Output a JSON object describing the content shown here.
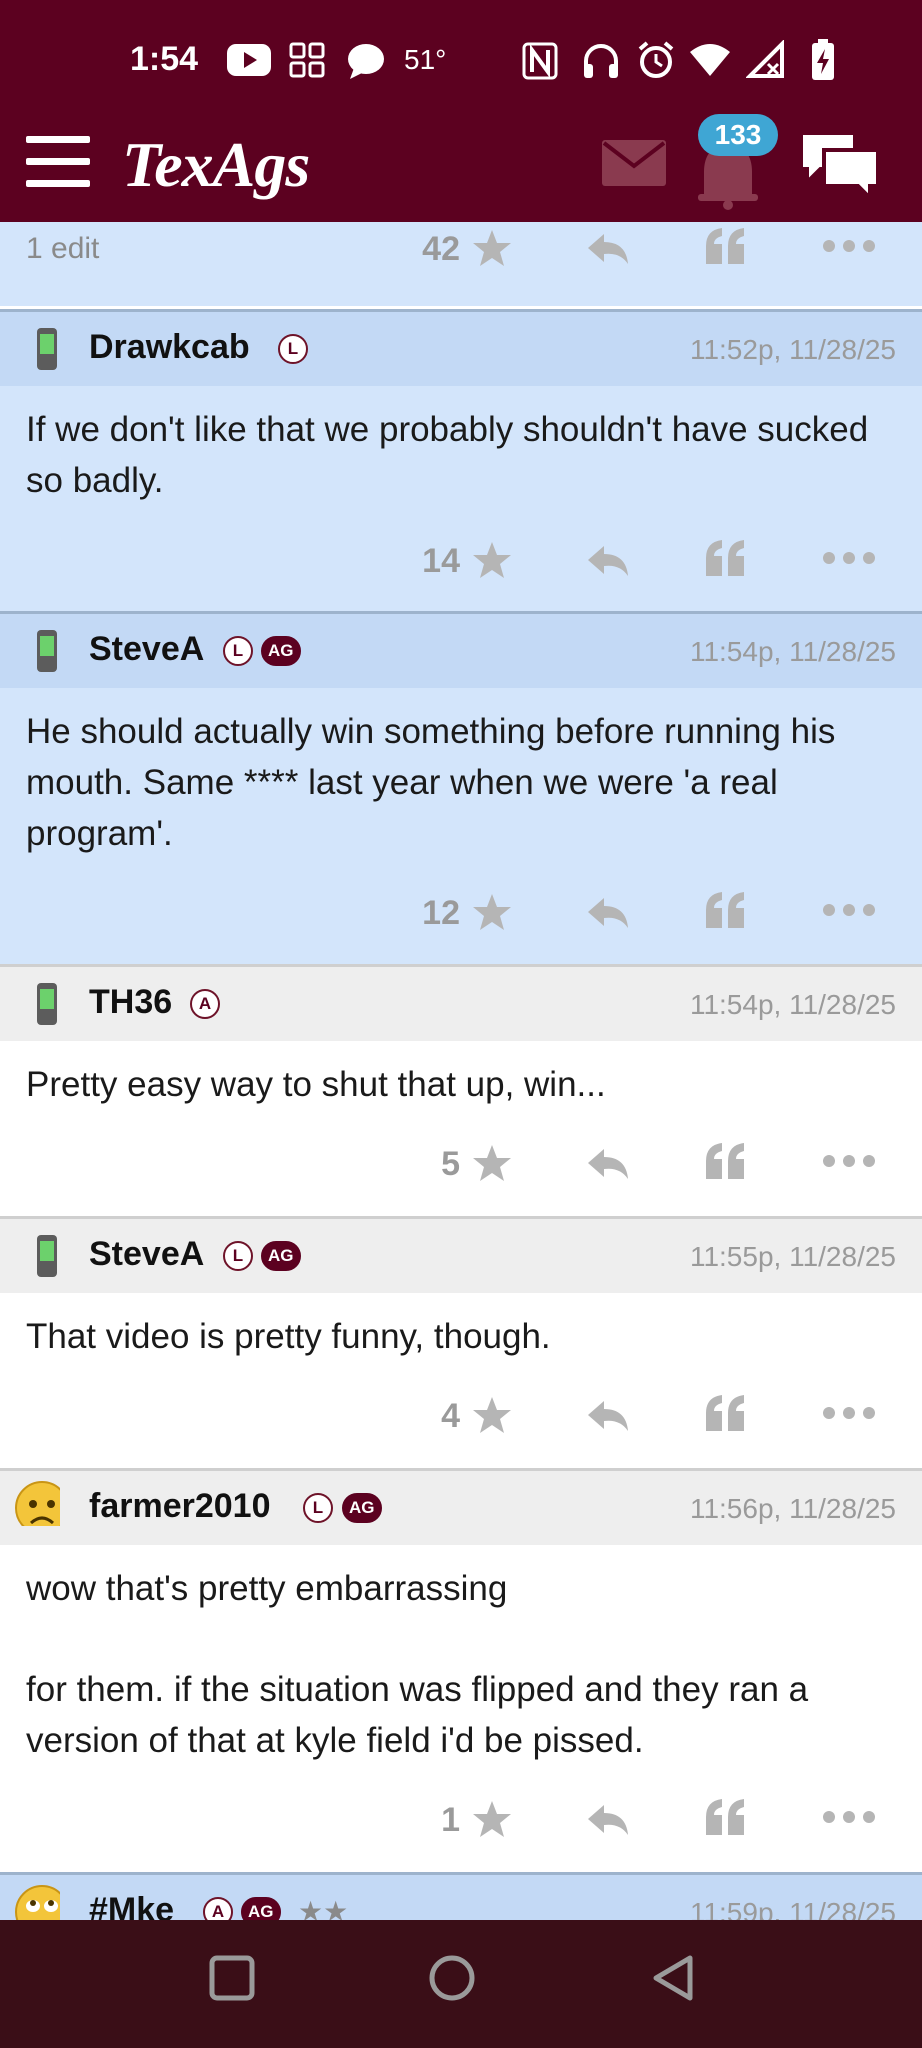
{
  "status_bar": {
    "time": "1:54",
    "temperature": "51°",
    "icons": [
      "youtube-icon",
      "grid-icon",
      "message-bubble-icon",
      "nfc-icon",
      "headphones-icon",
      "alarm-icon",
      "wifi-icon",
      "cell-signal-off-icon",
      "battery-charging-icon"
    ]
  },
  "header": {
    "logo": "TexAgs",
    "notification_count": "133",
    "icons": [
      "menu-icon",
      "mail-icon",
      "bell-icon",
      "chat-icon"
    ],
    "brand_color": "#5c0120"
  },
  "top_partial": {
    "edit_note": "1 edit",
    "score": "42"
  },
  "posts": [
    {
      "user": "Drawkcab",
      "badges": [
        "L"
      ],
      "time": "11:52p, 11/28/25",
      "body": [
        "If we don't like that we probably shouldn't have sucked so badly."
      ],
      "score": "14",
      "highlighted": true
    },
    {
      "user": "SteveA",
      "badges": [
        "L",
        "AG"
      ],
      "time": "11:54p, 11/28/25",
      "body": [
        "He should actually win something before running his mouth. Same **** last year when we were 'a real program'."
      ],
      "score": "12",
      "highlighted": true
    },
    {
      "user": "TH36",
      "badges": [
        "A"
      ],
      "time": "11:54p, 11/28/25",
      "body": [
        "Pretty easy way to shut that up, win..."
      ],
      "score": "5",
      "highlighted": false
    },
    {
      "user": "SteveA",
      "badges": [
        "L",
        "AG"
      ],
      "time": "11:55p, 11/28/25",
      "body": [
        "That video is pretty funny, though."
      ],
      "score": "4",
      "highlighted": false
    },
    {
      "user": "farmer2010",
      "badges": [
        "L",
        "AG"
      ],
      "time": "11:56p, 11/28/25",
      "body": [
        "wow that's pretty embarrassing",
        "for them. if the situation was flipped and they ran a version of that at kyle field i'd be pissed."
      ],
      "score": "1",
      "highlighted": false
    },
    {
      "user": "#Mke",
      "badges": [
        "A",
        "AG"
      ],
      "stars": "★★",
      "time": "11:59p, 11/28/25",
      "body": [],
      "highlighted": true
    }
  ],
  "nav_buttons": [
    "recents-square-icon",
    "home-circle-icon",
    "back-triangle-icon"
  ]
}
